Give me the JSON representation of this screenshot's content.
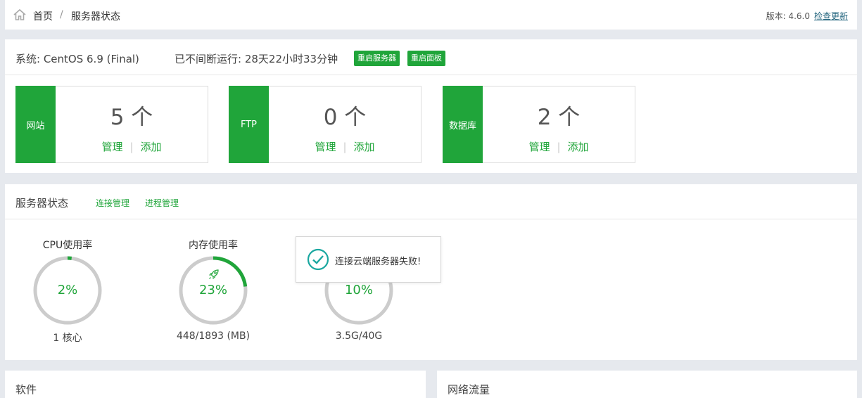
{
  "breadcrumb": {
    "home": "首页",
    "separator": "/",
    "current": "服务器状态"
  },
  "version": {
    "label": "版本: 4.6.0",
    "check_update": "检查更新"
  },
  "system": {
    "os": "系统: CentOS 6.9 (Final)",
    "uptime": "已不间断运行: 28天22小时33分钟",
    "restart_server": "重启服务器",
    "restart_panel": "重启面板"
  },
  "cards": [
    {
      "tag": "网站",
      "count": "5 个",
      "manage": "管理",
      "add": "添加"
    },
    {
      "tag": "FTP",
      "count": "0 个",
      "manage": "管理",
      "add": "添加"
    },
    {
      "tag": "数据库",
      "count": "2 个",
      "manage": "管理",
      "add": "添加"
    }
  ],
  "status": {
    "title": "服务器状态",
    "conn_manage": "连接管理",
    "proc_manage": "进程管理",
    "gauges": [
      {
        "title": "CPU使用率",
        "value": "2%",
        "percent": 2,
        "sub": "1 核心"
      },
      {
        "title": "内存使用率",
        "value": "23%",
        "percent": 23,
        "sub": "448/1893 (MB)",
        "icon": "rocket-icon"
      },
      {
        "title": "",
        "value": "10%",
        "percent": 10,
        "sub": "3.5G/40G"
      }
    ]
  },
  "toast": {
    "message": "连接云端服务器失败!",
    "icon": "check-circle-icon"
  },
  "bottom": {
    "software": "软件",
    "network": "网络流量"
  },
  "colors": {
    "accent": "#20a53a",
    "track": "#cccccc",
    "link": "#20637c"
  }
}
